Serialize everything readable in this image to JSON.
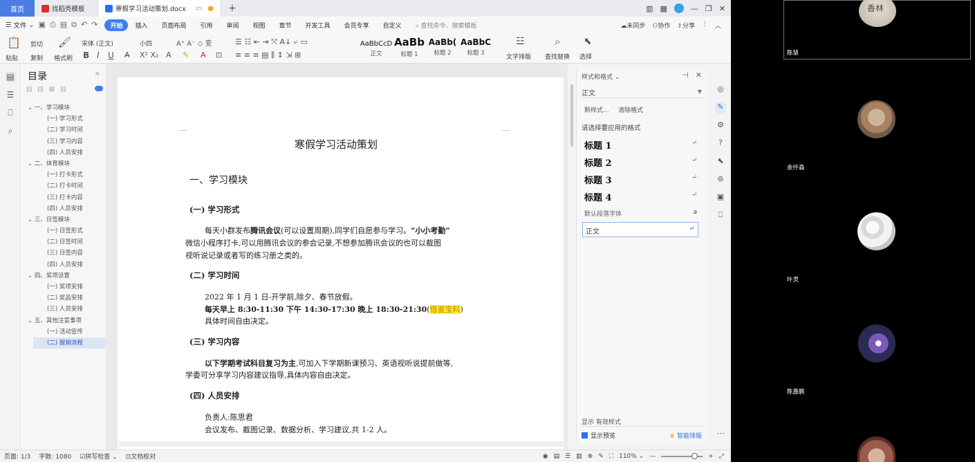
{
  "titlebar": {
    "home": "首页",
    "tabs": [
      {
        "label": "找稻壳模板"
      },
      {
        "label": "寒假学习活动策划.docx"
      }
    ],
    "plus": "+"
  },
  "menubar": {
    "file": "文件",
    "items": [
      "开始",
      "插入",
      "页面布局",
      "引用",
      "审阅",
      "视图",
      "章节",
      "开发工具",
      "会员专享",
      "自定义"
    ],
    "search": "查找命令、搜索模板",
    "right": [
      "未同步",
      "协作",
      "分享"
    ]
  },
  "ribbon": {
    "paste": "粘贴",
    "cut": "剪切",
    "copy": "复制",
    "format_painter": "格式刷",
    "font_name": "宋体 (正文)",
    "font_size": "小四",
    "styles": [
      {
        "preview": "AaBbCcD",
        "label": "正文"
      },
      {
        "preview": "AaBb",
        "label": "标题 1"
      },
      {
        "preview": "AaBb(",
        "label": "标题 2"
      },
      {
        "preview": "AaBbC",
        "label": "标题 3"
      }
    ],
    "text_layout": "文字排版",
    "find_replace": "查找替换",
    "select": "选择"
  },
  "toc": {
    "title": "目录",
    "items": [
      {
        "label": "一、学习模块",
        "level": 1
      },
      {
        "label": "(一) 学习形式",
        "level": 2
      },
      {
        "label": "(二) 学习时间",
        "level": 2
      },
      {
        "label": "(三) 学习内容",
        "level": 2
      },
      {
        "label": "(四) 人员安排",
        "level": 2
      },
      {
        "label": "二、体育模块",
        "level": 1
      },
      {
        "label": "(一) 打卡形式",
        "level": 2
      },
      {
        "label": "(二) 打卡时间",
        "level": 2
      },
      {
        "label": "(三) 打卡内容",
        "level": 2
      },
      {
        "label": "(四) 人员安排",
        "level": 2
      },
      {
        "label": "三、日签模块",
        "level": 1
      },
      {
        "label": "(一) 日签形式",
        "level": 2
      },
      {
        "label": "(二) 日签时间",
        "level": 2
      },
      {
        "label": "(三) 日签内容",
        "level": 2
      },
      {
        "label": "(四) 人员安排",
        "level": 2
      },
      {
        "label": "四、奖项设置",
        "level": 1
      },
      {
        "label": "(一) 奖项安排",
        "level": 2
      },
      {
        "label": "(二) 奖品安排",
        "level": 2
      },
      {
        "label": "(三) 人员安排",
        "level": 2
      },
      {
        "label": "五、其他注意事项",
        "level": 1
      },
      {
        "label": "(一) 活动宣传",
        "level": 2
      },
      {
        "label": "(二) 报销流程",
        "level": 2
      }
    ]
  },
  "doc": {
    "title": "寒假学习活动策划",
    "h1": "一、学习模块",
    "s1": {
      "heading": "(一) 学习形式",
      "p1a": "每天小群发布",
      "p1b": "腾讯会议",
      "p1c": "(可以设置周期),同学们自愿参与学习。",
      "p1d": "“小小考勤”",
      "p2": "微信小程序打卡,可以用腾讯会议的参会记录,不想参加腾讯会议的也可以截图",
      "p3": "视听说记录或者写的练习册之类的。"
    },
    "s2": {
      "heading": "(二) 学习时间",
      "p1": "2022 年 1 月 1 日-开学前,除夕、春节放假。",
      "p2a": "每天早上 8:30-11:30  下午 14:30-17:30  晚上 18:30-21:30",
      "p2b": "(",
      "p2c": "借鉴宝科",
      "p2d": ")",
      "p3": "具体时间自由决定。"
    },
    "s3": {
      "heading": "(三) 学习内容",
      "p1a": "以下学期考试科目复习为主",
      "p1b": ",可加入下学期新课预习、英语视听说提前做等,",
      "p2": "学委可分享学习内容建议指导,具体内容自由决定。"
    },
    "s4": {
      "heading": "(四) 人员安排",
      "p1": "负责人:陈思君",
      "p2": "会议发布、截图记录、数据分析、学习建议,共 1-2 人。"
    }
  },
  "stylepane": {
    "title": "样式和格式",
    "current": "正文",
    "new_style": "新样式...",
    "clear": "清除格式",
    "hint": "请选择要应用的格式",
    "styles": [
      "标题 1",
      "标题 2",
      "标题 3",
      "标题 4"
    ],
    "default_font": "默认段落字体",
    "default_font_mark": "a",
    "selected": "正文",
    "show_label": "显示",
    "show_value": "有效样式",
    "preview": "显示预览",
    "smart": "智能排版"
  },
  "statusbar": {
    "page": "页面: 1/3",
    "words": "字数: 1080",
    "spell": "拼写检查",
    "proof": "文档校对",
    "zoom": "110%"
  },
  "participants": {
    "main_face": "香林",
    "main_name": "陈慧",
    "people": [
      "余仟森",
      "叶灵",
      "陈嘉鹏"
    ]
  }
}
